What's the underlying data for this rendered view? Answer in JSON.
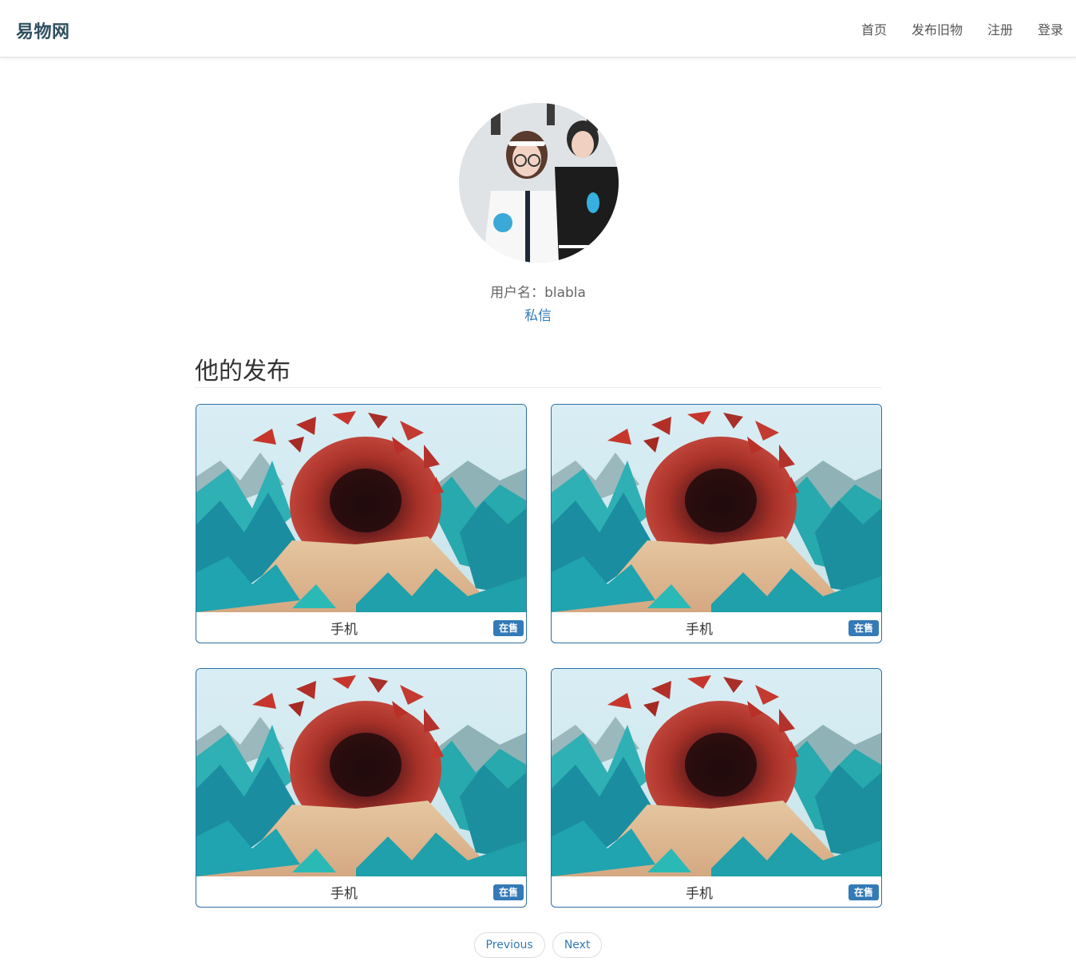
{
  "brand": "易物网",
  "nav": {
    "items": [
      {
        "label": "首页"
      },
      {
        "label": "发布旧物"
      },
      {
        "label": "注册"
      },
      {
        "label": "登录"
      }
    ]
  },
  "profile": {
    "username_label": "用户名：",
    "username": "blabla",
    "message_link": "私信"
  },
  "section": {
    "title": "他的发布"
  },
  "items": [
    {
      "title": "手机",
      "status": "在售"
    },
    {
      "title": "手机",
      "status": "在售"
    },
    {
      "title": "手机",
      "status": "在售"
    },
    {
      "title": "手机",
      "status": "在售"
    }
  ],
  "pagination": {
    "previous": "Previous",
    "next": "Next"
  },
  "colors": {
    "brand": "#2f4f5f",
    "link": "#337ab7",
    "badge": "#337ab7",
    "card_border": "#2e6da4"
  }
}
